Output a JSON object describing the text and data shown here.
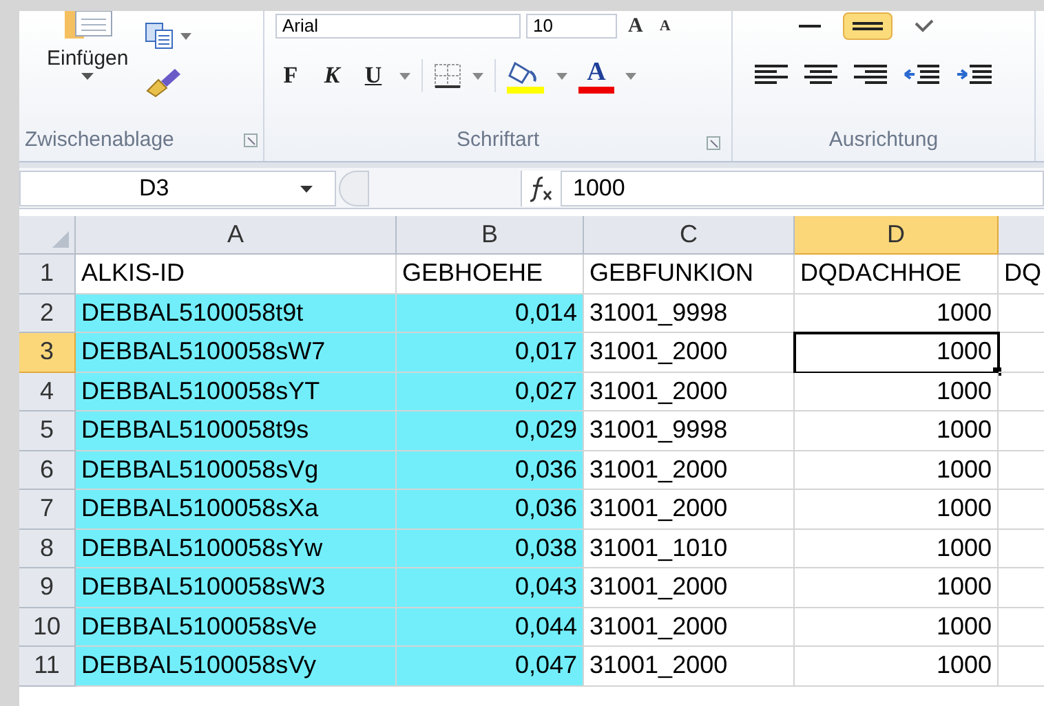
{
  "ribbon": {
    "clipboard": {
      "paste_label": "Einfügen",
      "group_label": "Zwischenablage"
    },
    "font": {
      "font_name": "Arial",
      "font_size": "10",
      "grow_glyph": "A",
      "shrink_glyph": "A",
      "bold_key": "F",
      "italic_key": "K",
      "underline_key": "U",
      "font_color_glyph": "A",
      "group_label": "Schriftart"
    },
    "alignment": {
      "group_label": "Ausrichtung"
    }
  },
  "formula_bar": {
    "name_box": "D3",
    "value": "1000"
  },
  "columns": [
    {
      "letter": "A",
      "numeric": false,
      "selected": false
    },
    {
      "letter": "B",
      "numeric": true,
      "selected": false
    },
    {
      "letter": "C",
      "numeric": false,
      "selected": false
    },
    {
      "letter": "D",
      "numeric": true,
      "selected": true
    }
  ],
  "rows": [
    {
      "number": "1",
      "selected": false,
      "kind": "header",
      "cells": [
        {
          "text": "ALKIS-ID",
          "highlighted": false,
          "active": false
        },
        {
          "text": "GEBHOEHE",
          "highlighted": false,
          "active": false
        },
        {
          "text": "GEBFUNKION",
          "highlighted": false,
          "active": false
        },
        {
          "text": "DQDACHHOE",
          "highlighted": false,
          "active": false
        },
        {
          "text": "DQ",
          "highlighted": false,
          "active": false
        }
      ]
    },
    {
      "number": "2",
      "selected": false,
      "kind": "data",
      "cells": [
        {
          "text": "DEBBAL5100058t9t",
          "highlighted": true,
          "active": false
        },
        {
          "text": "0,014",
          "highlighted": true,
          "active": false
        },
        {
          "text": "31001_9998",
          "highlighted": false,
          "active": false
        },
        {
          "text": "1000",
          "highlighted": false,
          "active": false
        }
      ]
    },
    {
      "number": "3",
      "selected": true,
      "kind": "data",
      "cells": [
        {
          "text": "DEBBAL5100058sW7",
          "highlighted": true,
          "active": false
        },
        {
          "text": "0,017",
          "highlighted": true,
          "active": false
        },
        {
          "text": "31001_2000",
          "highlighted": false,
          "active": false
        },
        {
          "text": "1000",
          "highlighted": false,
          "active": true
        }
      ]
    },
    {
      "number": "4",
      "selected": false,
      "kind": "data",
      "cells": [
        {
          "text": "DEBBAL5100058sYT",
          "highlighted": true,
          "active": false
        },
        {
          "text": "0,027",
          "highlighted": true,
          "active": false
        },
        {
          "text": "31001_2000",
          "highlighted": false,
          "active": false
        },
        {
          "text": "1000",
          "highlighted": false,
          "active": false
        }
      ]
    },
    {
      "number": "5",
      "selected": false,
      "kind": "data",
      "cells": [
        {
          "text": "DEBBAL5100058t9s",
          "highlighted": true,
          "active": false
        },
        {
          "text": "0,029",
          "highlighted": true,
          "active": false
        },
        {
          "text": "31001_9998",
          "highlighted": false,
          "active": false
        },
        {
          "text": "1000",
          "highlighted": false,
          "active": false
        }
      ]
    },
    {
      "number": "6",
      "selected": false,
      "kind": "data",
      "cells": [
        {
          "text": "DEBBAL5100058sVg",
          "highlighted": true,
          "active": false
        },
        {
          "text": "0,036",
          "highlighted": true,
          "active": false
        },
        {
          "text": "31001_2000",
          "highlighted": false,
          "active": false
        },
        {
          "text": "1000",
          "highlighted": false,
          "active": false
        }
      ]
    },
    {
      "number": "7",
      "selected": false,
      "kind": "data",
      "cells": [
        {
          "text": "DEBBAL5100058sXa",
          "highlighted": true,
          "active": false
        },
        {
          "text": "0,036",
          "highlighted": true,
          "active": false
        },
        {
          "text": "31001_2000",
          "highlighted": false,
          "active": false
        },
        {
          "text": "1000",
          "highlighted": false,
          "active": false
        }
      ]
    },
    {
      "number": "8",
      "selected": false,
      "kind": "data",
      "cells": [
        {
          "text": "DEBBAL5100058sYw",
          "highlighted": true,
          "active": false
        },
        {
          "text": "0,038",
          "highlighted": true,
          "active": false
        },
        {
          "text": "31001_1010",
          "highlighted": false,
          "active": false
        },
        {
          "text": "1000",
          "highlighted": false,
          "active": false
        }
      ]
    },
    {
      "number": "9",
      "selected": false,
      "kind": "data",
      "cells": [
        {
          "text": "DEBBAL5100058sW3",
          "highlighted": true,
          "active": false
        },
        {
          "text": "0,043",
          "highlighted": true,
          "active": false
        },
        {
          "text": "31001_2000",
          "highlighted": false,
          "active": false
        },
        {
          "text": "1000",
          "highlighted": false,
          "active": false
        }
      ]
    },
    {
      "number": "10",
      "selected": false,
      "kind": "data",
      "cells": [
        {
          "text": "DEBBAL5100058sVe",
          "highlighted": true,
          "active": false
        },
        {
          "text": "0,044",
          "highlighted": true,
          "active": false
        },
        {
          "text": "31001_2000",
          "highlighted": false,
          "active": false
        },
        {
          "text": "1000",
          "highlighted": false,
          "active": false
        }
      ]
    },
    {
      "number": "11",
      "selected": false,
      "kind": "data",
      "cells": [
        {
          "text": "DEBBAL5100058sVy",
          "highlighted": true,
          "active": false
        },
        {
          "text": "0,047",
          "highlighted": true,
          "active": false
        },
        {
          "text": "31001_2000",
          "highlighted": false,
          "active": false
        },
        {
          "text": "1000",
          "highlighted": false,
          "active": false
        }
      ]
    }
  ]
}
